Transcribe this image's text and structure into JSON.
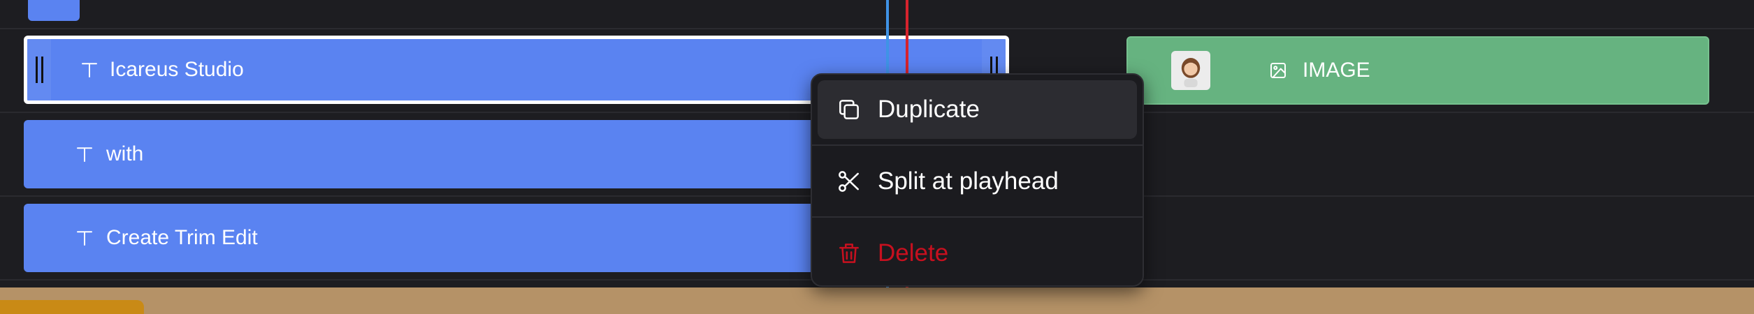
{
  "timeline": {
    "clips": [
      {
        "label": "Icareus Studio",
        "type": "text",
        "icon": "text-icon",
        "selected": true
      },
      {
        "label": "with",
        "type": "text",
        "icon": "text-icon",
        "selected": false
      },
      {
        "label": "Create Trim Edit",
        "type": "text",
        "icon": "text-icon",
        "selected": false
      },
      {
        "label": "IMAGE",
        "type": "image",
        "icon": "image-icon",
        "thumbnail": "avatar-thumbnail"
      }
    ]
  },
  "context_menu": {
    "items": [
      {
        "label": "Duplicate",
        "icon": "duplicate-icon"
      },
      {
        "label": "Split at playhead",
        "icon": "scissors-icon"
      },
      {
        "label": "Delete",
        "icon": "trash-icon"
      }
    ]
  },
  "colors": {
    "background": "#1d1d21",
    "text_clip": "#5a83f1",
    "image_clip": "#66b380",
    "playhead_blue": "#3f93e6",
    "playhead_red": "#d6232d",
    "delete_red": "#c7101f",
    "bottom_track": "#b59267"
  }
}
